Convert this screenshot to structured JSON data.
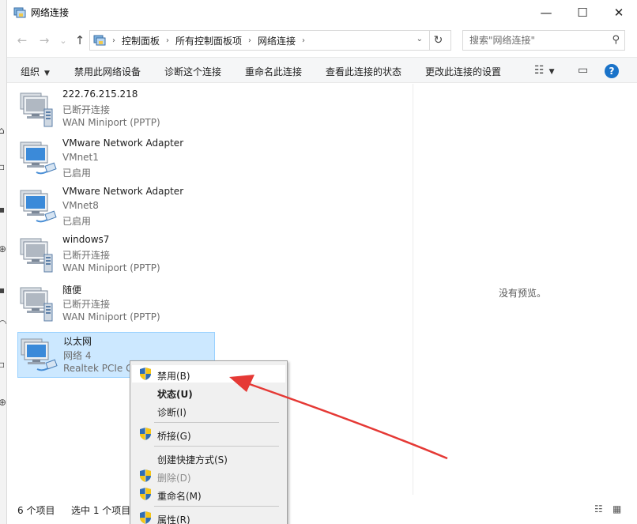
{
  "window": {
    "title": "网络连接",
    "minimize_glyph": "—",
    "maximize_glyph": "☐",
    "close_glyph": "✕"
  },
  "nav": {
    "back_glyph": "←",
    "forward_glyph": "→",
    "recent_glyph": "⌄",
    "up_glyph": "↑",
    "refresh_glyph": "↻"
  },
  "breadcrumbs": [
    "控制面板",
    "所有控制面板项",
    "网络连接"
  ],
  "search": {
    "placeholder": "搜索\"网络连接\""
  },
  "toolbar": {
    "organize": "组织",
    "disable_device": "禁用此网络设备",
    "diagnose": "诊断这个连接",
    "rename": "重命名此连接",
    "view_status": "查看此连接的状态",
    "change_settings": "更改此连接的设置",
    "help_glyph": "?"
  },
  "connections": [
    {
      "name": "222.76.215.218",
      "status": "已断开连接",
      "device": "WAN Miniport (PPTP)",
      "kind": "wan"
    },
    {
      "name": "VMware Network Adapter",
      "status": "VMnet1",
      "device": "已启用",
      "kind": "eth"
    },
    {
      "name": "VMware Network Adapter",
      "status": "VMnet8",
      "device": "已启用",
      "kind": "eth"
    },
    {
      "name": "windows7",
      "status": "已断开连接",
      "device": "WAN Miniport (PPTP)",
      "kind": "wan"
    },
    {
      "name": "随便",
      "status": "已断开连接",
      "device": "WAN Miniport (PPTP)",
      "kind": "wan"
    },
    {
      "name": "以太网",
      "status": "网络 4",
      "device": "Realtek PCIe G",
      "kind": "eth",
      "selected": true
    }
  ],
  "preview": {
    "empty_text": "没有预览。"
  },
  "statusbar": {
    "item_count": "6 个项目",
    "selected_count": "选中 1 个项目"
  },
  "context_menu": {
    "items": [
      {
        "label": "禁用(B)",
        "shield": true,
        "hover": true
      },
      {
        "label": "状态(U)",
        "bold": true
      },
      {
        "label": "诊断(I)"
      },
      {
        "label": "桥接(G)",
        "shield": true
      },
      {
        "label": "创建快捷方式(S)"
      },
      {
        "label": "删除(D)",
        "shield": true,
        "disabled": true
      },
      {
        "label": "重命名(M)",
        "shield": true
      },
      {
        "label": "属性(R)",
        "shield": true
      }
    ]
  },
  "colors": {
    "selection": "#cce8ff",
    "accent_blue": "#1a73c9",
    "annotation_arrow": "#e53935"
  }
}
